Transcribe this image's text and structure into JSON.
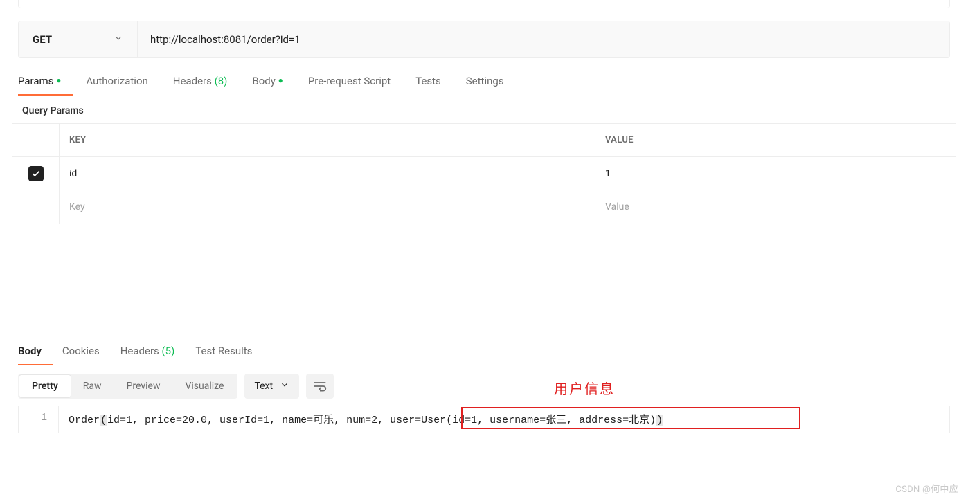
{
  "request": {
    "method": "GET",
    "url": "http://localhost:8081/order?id=1"
  },
  "tabs": {
    "params": {
      "label": "Params",
      "has_dot": true,
      "active": true
    },
    "authorization": {
      "label": "Authorization"
    },
    "headers": {
      "label": "Headers",
      "count": "(8)"
    },
    "body": {
      "label": "Body",
      "has_dot": true
    },
    "prerequest": {
      "label": "Pre-request Script"
    },
    "tests": {
      "label": "Tests"
    },
    "settings": {
      "label": "Settings"
    }
  },
  "query_params": {
    "section_title": "Query Params",
    "header": {
      "key": "KEY",
      "value": "VALUE"
    },
    "rows": [
      {
        "checked": true,
        "key": "id",
        "value": "1"
      }
    ],
    "placeholder": {
      "key": "Key",
      "value": "Value"
    }
  },
  "response_tabs": {
    "body": {
      "label": "Body",
      "active": true
    },
    "cookies": {
      "label": "Cookies"
    },
    "headers": {
      "label": "Headers",
      "count": "(5)"
    },
    "test_results": {
      "label": "Test Results"
    }
  },
  "view_modes": {
    "pretty": "Pretty",
    "raw": "Raw",
    "preview": "Preview",
    "visualize": "Visualize"
  },
  "format": "Text",
  "response_body": {
    "line_no": "1",
    "prefix": "Order",
    "content_a": "id=1, price=20.0, userId=1, name=可乐, num=2, ",
    "content_b": "user=User(id=1, username=张三, address=北京)"
  },
  "annotation": {
    "label": "用户信息"
  },
  "watermark": "CSDN @何中应"
}
